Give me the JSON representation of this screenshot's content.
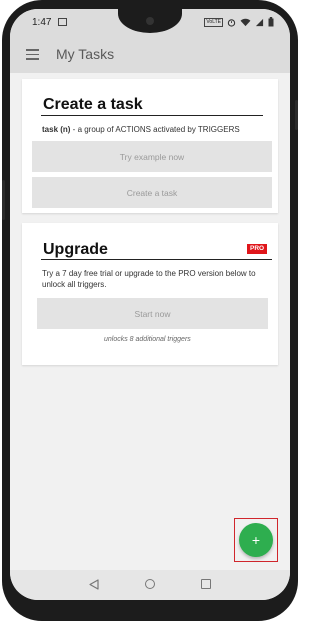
{
  "status_bar": {
    "time": "1:47",
    "network_label": "VoLTE",
    "battery_percent": ""
  },
  "app_bar": {
    "title": "My Tasks",
    "menu_icon": "hamburger-menu-icon"
  },
  "create_card": {
    "title": "Create a task",
    "desc_term": "task (n)",
    "desc_rest": " - a group of ACTIONS activated by TRIGGERS",
    "try_example_label": "Try example now",
    "create_label": "Create a task"
  },
  "upgrade_card": {
    "title": "Upgrade",
    "badge": "PRO",
    "badge_color": "#e0161b",
    "description": "Try a 7 day free trial or upgrade to the PRO version below to unlock all triggers.",
    "start_label": "Start now",
    "unlocks_note": "unlocks 8 additional triggers"
  },
  "fab": {
    "label": "+",
    "icon": "plus-icon",
    "color": "#2eae4f",
    "highlight_color": "#d0262c"
  },
  "nav_bar": {
    "icons": [
      "back-icon",
      "home-icon",
      "recents-icon"
    ]
  }
}
